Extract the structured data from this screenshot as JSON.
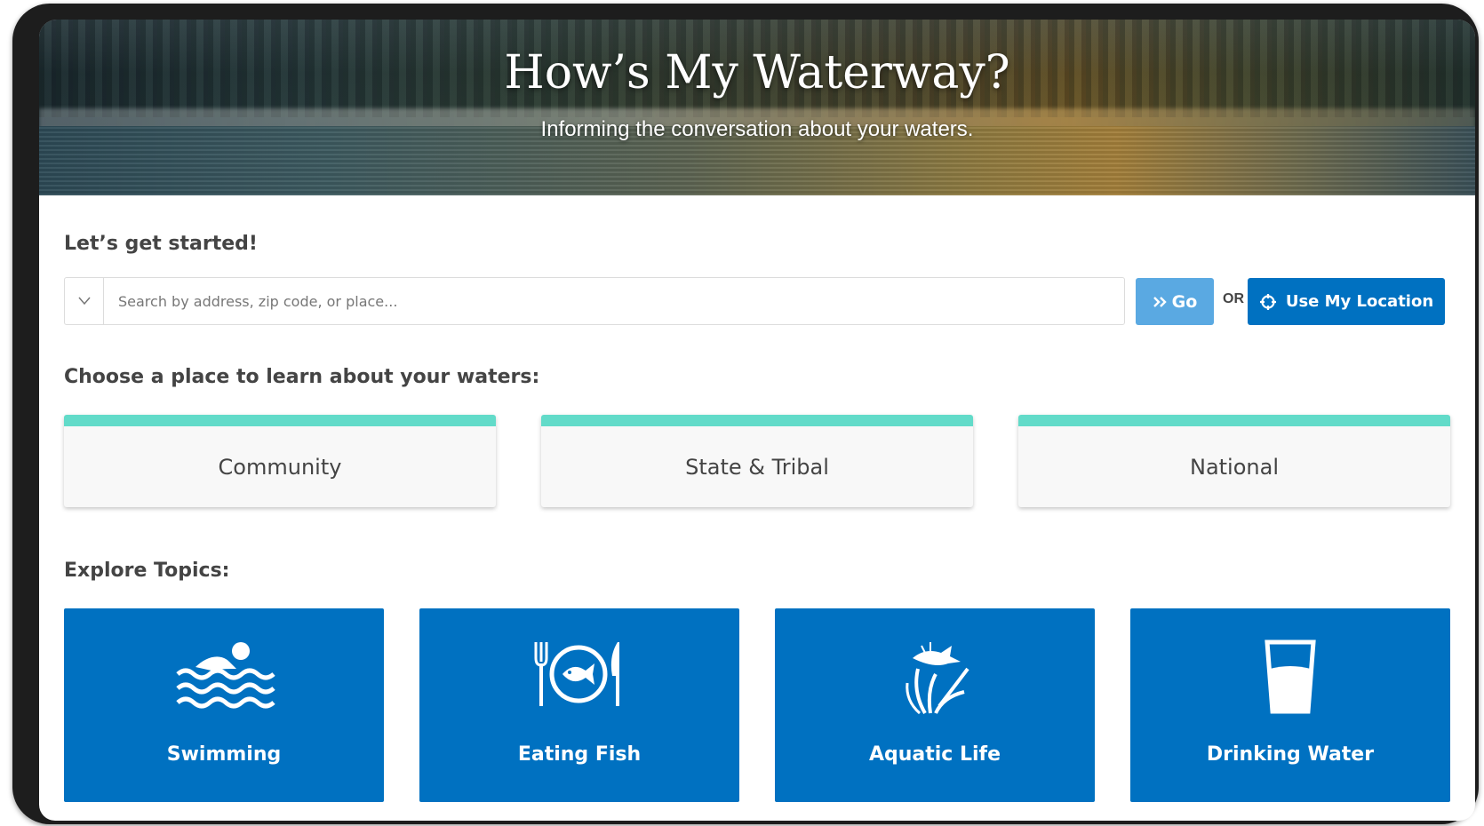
{
  "hero": {
    "title": "How’s My Waterway?",
    "subtitle": "Informing the conversation about your waters."
  },
  "search": {
    "heading": "Let’s get started!",
    "placeholder": "Search by address, zip code, or place...",
    "go_label": "Go",
    "or_label": "OR",
    "location_label": "Use My Location"
  },
  "places": {
    "heading": "Choose a place to learn about your waters:",
    "items": [
      {
        "label": "Community"
      },
      {
        "label": "State & Tribal"
      },
      {
        "label": "National"
      }
    ]
  },
  "topics": {
    "heading": "Explore Topics:",
    "items": [
      {
        "label": "Swimming",
        "icon": "swimming-icon"
      },
      {
        "label": "Eating Fish",
        "icon": "fish-plate-icon"
      },
      {
        "label": "Aquatic Life",
        "icon": "aquatic-life-icon"
      },
      {
        "label": "Drinking Water",
        "icon": "water-glass-icon"
      }
    ]
  },
  "colors": {
    "primary": "#0071c1",
    "go_button": "#5aa9e2",
    "place_accent": "#62dbc9"
  }
}
